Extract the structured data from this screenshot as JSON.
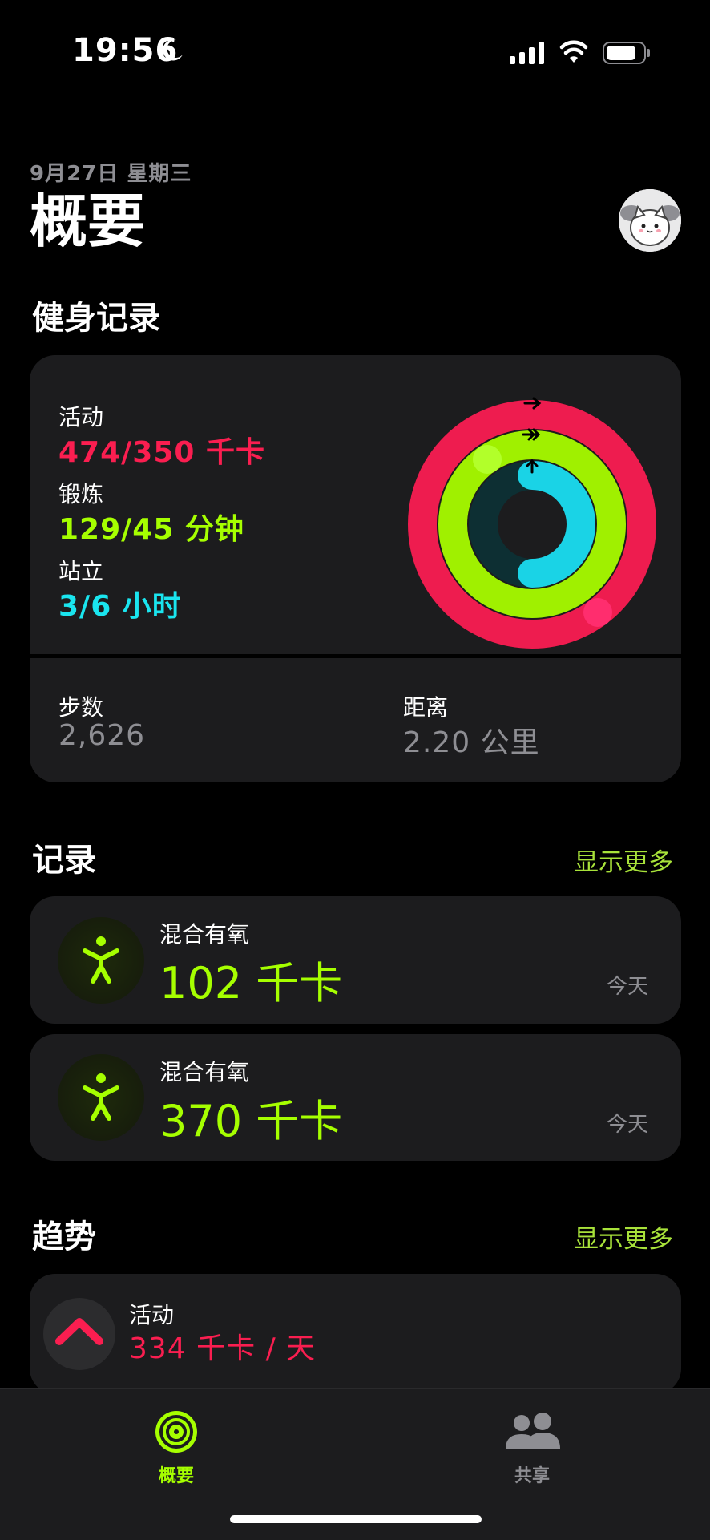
{
  "status": {
    "time": "19:56"
  },
  "header": {
    "date": "9月27日 星期三",
    "title": "概要"
  },
  "fitness": {
    "section_title": "健身记录",
    "move": {
      "label": "活动",
      "value": "474/350 千卡",
      "color": "#fa1e50"
    },
    "exercise": {
      "label": "锻炼",
      "value": "129/45 分钟",
      "color": "#a6ff00"
    },
    "stand": {
      "label": "站立",
      "value": "3/6 小时",
      "color": "#1ae5ef"
    },
    "rings": {
      "move_progress": 1.354,
      "exercise_progress": 2.867,
      "stand_progress": 0.5
    },
    "steps": {
      "label": "步数",
      "value": "2,626"
    },
    "distance": {
      "label": "距离",
      "value": "2.20 公里"
    }
  },
  "records": {
    "section_title": "记录",
    "more": "显示更多",
    "items": [
      {
        "name": "混合有氧",
        "value": "102 千卡",
        "date": "今天",
        "icon": "running-figure-icon"
      },
      {
        "name": "混合有氧",
        "value": "370 千卡",
        "date": "今天",
        "icon": "running-figure-icon"
      }
    ]
  },
  "trends": {
    "section_title": "趋势",
    "more": "显示更多",
    "item": {
      "label": "活动",
      "value": "334 千卡 / 天",
      "icon": "chevron-up-icon"
    }
  },
  "tabs": [
    {
      "label": "概要",
      "active": true,
      "icon": "activity-rings-icon"
    },
    {
      "label": "共享",
      "active": false,
      "icon": "people-icon"
    }
  ],
  "colors": {
    "accent": "#a8e23a",
    "move": "#fa1e50",
    "exercise": "#a6ff00",
    "stand": "#1ae5ef",
    "card": "#1c1c1e"
  }
}
